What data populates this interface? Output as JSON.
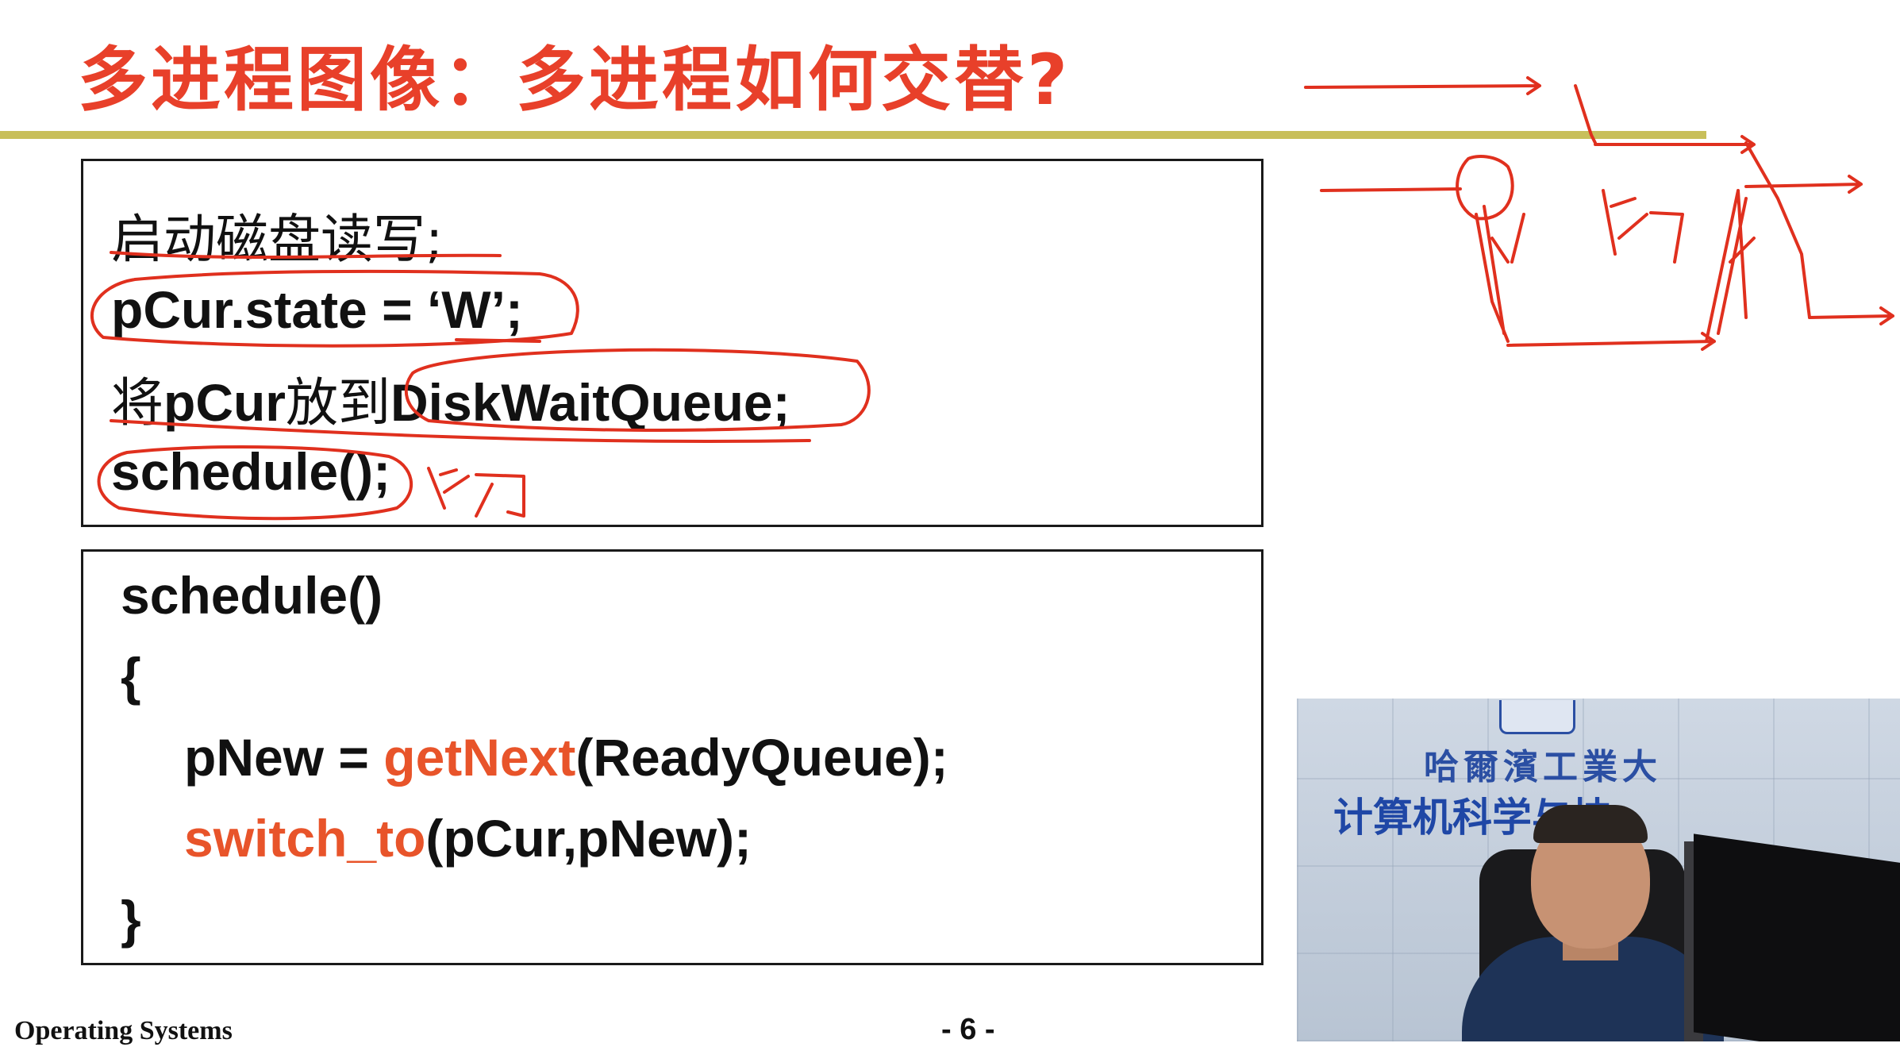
{
  "slide": {
    "title": "多进程图像：多进程如何交替?",
    "box1": {
      "line1": "启动磁盘读写;",
      "line2": "pCur.state = ‘W’;",
      "line3_prefix": "将",
      "line3_a": "pCur",
      "line3_mid": "放到",
      "line3_b": "DiskWaitQueue;",
      "line4": "schedule();"
    },
    "box2": {
      "line1": "schedule()",
      "line2": "{",
      "line3_a": "pNew = ",
      "line3_fn": "getNext",
      "line3_b": "(ReadyQueue);",
      "line4_fn": "switch_to",
      "line4_b": "(pCur,pNew);",
      "line5": "}"
    },
    "footer": {
      "left": "Operating Systems",
      "page": "- 6 -"
    },
    "colors": {
      "title": "#e8402a",
      "rule": "#c8bf5a",
      "function_name": "#e8542a",
      "annotation": "#e0301e"
    }
  },
  "video": {
    "university": "哈爾濱工業大",
    "department": "计算机科学与技"
  }
}
